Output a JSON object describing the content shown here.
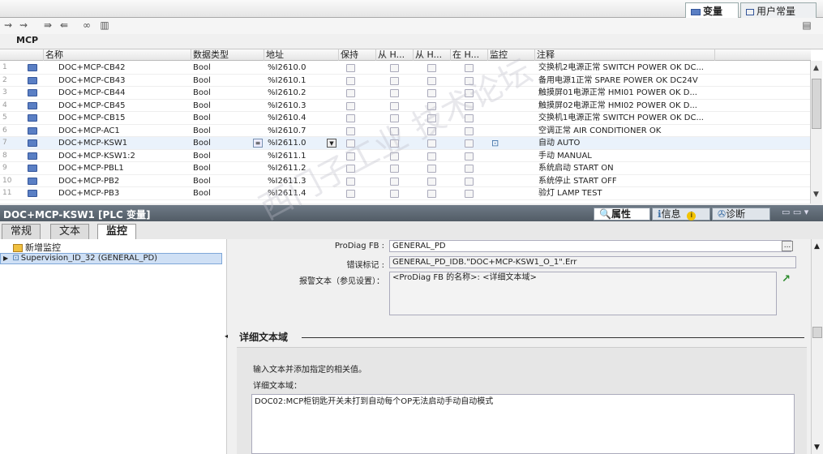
{
  "tabs": {
    "variables": "变量",
    "user_constants": "用户常量"
  },
  "table": {
    "name": "MCP",
    "columns": [
      "名称",
      "数据类型",
      "地址",
      "保持",
      "从 H...",
      "从 H...",
      "在 H...",
      "监控",
      "注释"
    ],
    "rows": [
      {
        "num": "1",
        "name": "DOC+MCP-CB42",
        "type": "Bool",
        "addr": "%I2610.0",
        "comment": "交换机2电源正常 SWITCH POWER OK DC..."
      },
      {
        "num": "2",
        "name": "DOC+MCP-CB43",
        "type": "Bool",
        "addr": "%I2610.1",
        "comment": "备用电源1正常 SPARE POWER OK DC24V"
      },
      {
        "num": "3",
        "name": "DOC+MCP-CB44",
        "type": "Bool",
        "addr": "%I2610.2",
        "comment": "触摸屏01电源正常 HMI01 POWER OK D..."
      },
      {
        "num": "4",
        "name": "DOC+MCP-CB45",
        "type": "Bool",
        "addr": "%I2610.3",
        "comment": "触摸屏02电源正常 HMI02 POWER OK D..."
      },
      {
        "num": "5",
        "name": "DOC+MCP-CB15",
        "type": "Bool",
        "addr": "%I2610.4",
        "comment": "交换机1电源正常 SWITCH POWER OK DC..."
      },
      {
        "num": "6",
        "name": "DOC+MCP-AC1",
        "type": "Bool",
        "addr": "%I2610.7",
        "comment": "空调正常 AIR CONDITIONER OK"
      },
      {
        "num": "7",
        "name": "DOC+MCP-KSW1",
        "type": "Bool",
        "addr": "%I2611.0",
        "comment": "自动 AUTO"
      },
      {
        "num": "8",
        "name": "DOC+MCP-KSW1:2",
        "type": "Bool",
        "addr": "%I2611.1",
        "comment": "手动 MANUAL"
      },
      {
        "num": "9",
        "name": "DOC+MCP-PBL1",
        "type": "Bool",
        "addr": "%I2611.2",
        "comment": "系统启动 START ON"
      },
      {
        "num": "10",
        "name": "DOC+MCP-PB2",
        "type": "Bool",
        "addr": "%I2611.3",
        "comment": "系统停止 START OFF"
      },
      {
        "num": "11",
        "name": "DOC+MCP-PB3",
        "type": "Bool",
        "addr": "%I2611.4",
        "comment": "验灯 LAMP TEST"
      }
    ]
  },
  "inspector": {
    "title": "DOC+MCP-KSW1 [PLC 变量]",
    "tabs": {
      "properties": "属性",
      "info": "信息",
      "diagnostics": "诊断"
    },
    "subtabs": {
      "general": "常规",
      "text": "文本",
      "supervision": "监控"
    },
    "tree": {
      "add_new": "新增监控",
      "item": "Supervision_ID_32 (GENERAL_PD)"
    },
    "prodiag_label": "ProDiag FB :",
    "prodiag_value": "GENERAL_PD",
    "error_label": "错误标记 :",
    "error_value": "GENERAL_PD_IDB.\"DOC+MCP-KSW1_O_1\".Err",
    "alarm_label": "报警文本（参见设置）：",
    "alarm_value": "<ProDiag FB 的名称>: <详细文本域>",
    "detail_header": "详细文本域",
    "detail_hint": "输入文本并添加指定的相关值。",
    "detail_label": "详细文本域：",
    "detail_text": "DOC02:MCP柜钥匙开关未打到自动每个OP无法启动手动自动模式"
  }
}
